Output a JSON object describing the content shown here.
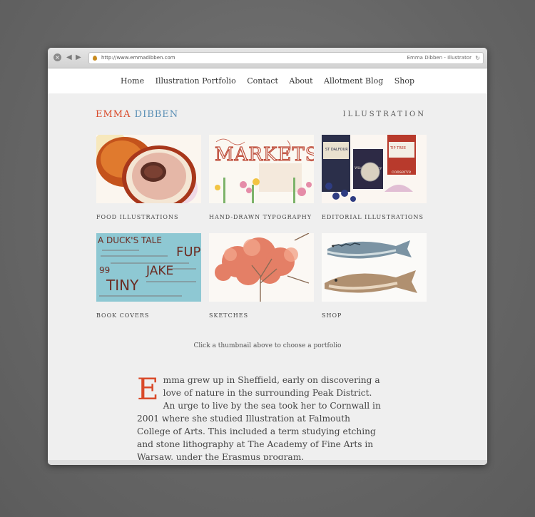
{
  "browser": {
    "url": "http://www.emmadibben.com",
    "page_title": "Emma Dibben - Illustrator"
  },
  "nav": {
    "items": [
      "Home",
      "Illustration Portfolio",
      "Contact",
      "About",
      "Allotment Blog",
      "Shop"
    ]
  },
  "header": {
    "logo_first": "EMMA",
    "logo_second": "DIBBEN",
    "section_title": "ILLUSTRATION"
  },
  "portfolio": {
    "tiles": [
      {
        "label": "FOOD ILLUSTRATIONS"
      },
      {
        "label": "HAND-DRAWN TYPOGRAPHY",
        "art_text": "MARKETS"
      },
      {
        "label": "EDITORIAL ILLUSTRATIONS",
        "art_text": [
          "ST DALFOUR",
          "Wild Blueberry",
          "TIP TREE",
          "conserve"
        ]
      },
      {
        "label": "BOOK COVERS",
        "art_text": [
          "A DUCK'S TALE",
          "FUP",
          "99",
          "JAKE",
          "TINY"
        ]
      },
      {
        "label": "SKETCHES"
      },
      {
        "label": "SHOP"
      }
    ],
    "hint": "Click a thumbnail above to choose a portfolio"
  },
  "bio": {
    "dropcap": "E",
    "text": "mma grew up in Sheffield, early on discovering a love of nature in the surrounding Peak District. An urge to live by the sea took her to Cornwall in 2001 where she studied Illustration at Falmouth College of Arts. This included a term studying etching and stone lithography at The Academy of Fine Arts in Warsaw, under the Erasmus program."
  },
  "colors": {
    "accent_red": "#d94a2a",
    "accent_blue": "#5a8fb5"
  }
}
